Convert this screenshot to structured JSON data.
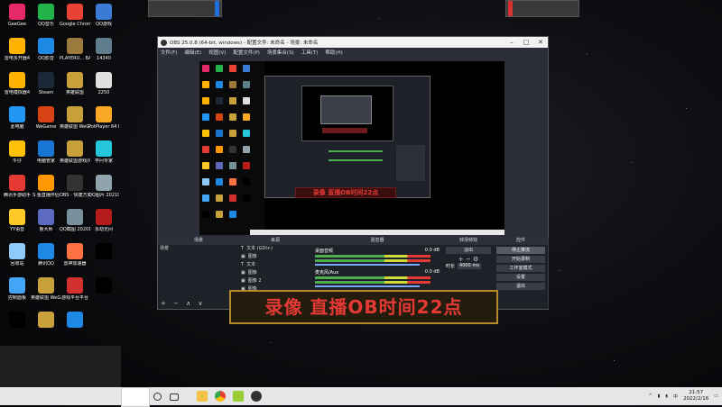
{
  "desktop": {
    "icons": [
      {
        "label": "GeeGee",
        "color": "#e6296a"
      },
      {
        "label": "QQ音乐",
        "color": "#21b34a"
      },
      {
        "label": "Google Chrome",
        "color": "#e94235"
      },
      {
        "label": "QQ游戏",
        "color": "#3a7bd5"
      },
      {
        "label": "雷电多开器4",
        "color": "#ffb300"
      },
      {
        "label": "QQ影音",
        "color": "#1e88e5"
      },
      {
        "label": "PLAYERU... BATTLEGR...",
        "color": "#9c7a3c"
      },
      {
        "label": "14340",
        "color": "#607d8b"
      },
      {
        "label": "雷电模拟器4",
        "color": "#ffb300"
      },
      {
        "label": "Steam",
        "color": "#1b2838"
      },
      {
        "label": "英雄联盟",
        "color": "#c9a13b"
      },
      {
        "label": "2250",
        "color": "#e0e0e0"
      },
      {
        "label": "此电脑",
        "color": "#2196f3"
      },
      {
        "label": "WeGame",
        "color": "#d84315"
      },
      {
        "label": "英雄联盟 WeGame版",
        "color": "#c9a13b"
      },
      {
        "label": "PotPlayer 64 bit",
        "color": "#f9a825"
      },
      {
        "label": "牛仔",
        "color": "#ffc107"
      },
      {
        "label": "电脑管家",
        "color": "#1976d2"
      },
      {
        "label": "英雄联盟游戏(Plus)",
        "color": "#c9a13b"
      },
      {
        "label": "学问专家",
        "color": "#26c6da"
      },
      {
        "label": "腾讯手游助手",
        "color": "#e53935"
      },
      {
        "label": "S·鱼直播伴侣",
        "color": "#ff9800"
      },
      {
        "label": "OBS - 快捷方式",
        "color": "#333333"
      },
      {
        "label": "QQ图片 20210615...",
        "color": "#90a4ae"
      },
      {
        "label": "YY语音",
        "color": "#ffca28"
      },
      {
        "label": "鲁大师",
        "color": "#5c6bc0"
      },
      {
        "label": "QQ截图 20201027...",
        "color": "#78909c"
      },
      {
        "label": "永劫无间",
        "color": "#b71c1c"
      },
      {
        "label": "回收站",
        "color": "#90caf9"
      },
      {
        "label": "腾讯QQ",
        "color": "#1e88e5"
      },
      {
        "label": "雷神加速器",
        "color": "#ff7043"
      },
      {
        "label": "",
        "color": "#000000"
      },
      {
        "label": "控制面板",
        "color": "#42a5f5"
      },
      {
        "label": "英雄联盟 WeGame版",
        "color": "#c9a13b"
      },
      {
        "label": "游戏平台平台",
        "color": "#d32f2f"
      },
      {
        "label": "",
        "color": "#000000"
      },
      {
        "label": "",
        "color": "#000000"
      },
      {
        "label": "",
        "color": "#c9a13b"
      },
      {
        "label": "",
        "color": "#1e88e5"
      }
    ]
  },
  "obs": {
    "title": "OBS 25.0.8 (64-bit, windows) - 配置文件: 未命名 - 场景: 未命名",
    "menu": [
      "文件(F)",
      "编辑(E)",
      "视图(V)",
      "配置文件(P)",
      "场景集合(S)",
      "工具(T)",
      "帮助(H)"
    ],
    "docks": {
      "scenes": {
        "header": "场景",
        "items": [
          "场景"
        ]
      },
      "sources": {
        "header": "来源",
        "items": [
          "文本 (GDI+)",
          "图像",
          "文本",
          "图像",
          "图像 2",
          "图像"
        ]
      },
      "mixer": {
        "header": "混音器",
        "channel1": "桌面音频",
        "db1": "0.0 dB",
        "channel2": "麦克风/Aux",
        "db2": "0.0 dB"
      },
      "transitions": {
        "header": "转场特效",
        "type": "淡出",
        "duration_label": "时长",
        "duration": "4000 ms"
      },
      "controls": {
        "header": "控件",
        "buttons": [
          "停止推流",
          "开始录制",
          "工作室模式",
          "设置",
          "退出"
        ]
      }
    },
    "inner_caption": "录像 直播OB时间22点"
  },
  "caption": "录像 直播OB时间22点",
  "taskbar": {
    "clock_time": "21:57",
    "clock_date": "2022/2/16"
  },
  "colors": {
    "accent_red": "#e53935",
    "caption_border": "#b58a2c",
    "obs_bg": "#2b2e38"
  }
}
